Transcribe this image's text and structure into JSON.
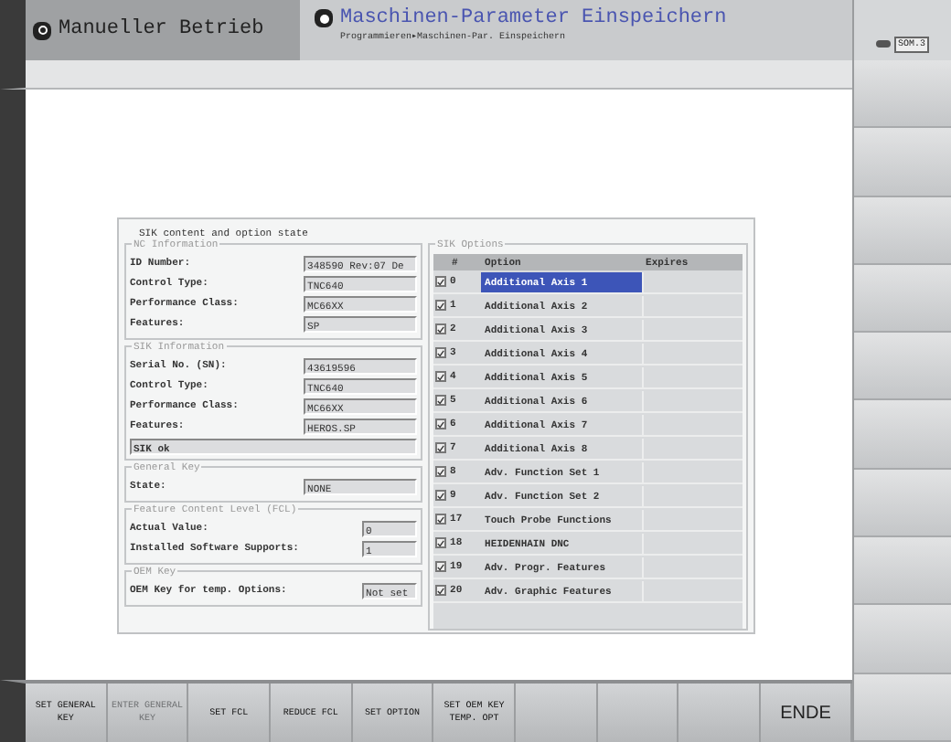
{
  "header": {
    "mode": "Manueller Betrieb",
    "title": "Maschinen-Parameter Einspeichern",
    "breadcrumb": "Programmieren▸Maschinen-Par. Einspeichern"
  },
  "side_status": "SOM.3",
  "dialog": {
    "title": "SIK content and option state",
    "groups": [
      {
        "legend": "NC Information",
        "fields": [
          {
            "label": "ID Number:",
            "value": "348590 Rev:07 De"
          },
          {
            "label": "Control Type:",
            "value": "TNC640"
          },
          {
            "label": "Performance Class:",
            "value": "MC66XX"
          },
          {
            "label": "Features:",
            "value": "SP"
          }
        ]
      },
      {
        "legend": "SIK Information",
        "fields": [
          {
            "label": "Serial No. (SN):",
            "value": "43619596"
          },
          {
            "label": "Control Type:",
            "value": "TNC640"
          },
          {
            "label": "Performance Class:",
            "value": "MC66XX"
          },
          {
            "label": "Features:",
            "value": "HEROS.SP"
          }
        ],
        "status": "SIK ok"
      },
      {
        "legend": "General Key",
        "fields": [
          {
            "label": "State:",
            "value": "NONE"
          }
        ]
      },
      {
        "legend": "Feature Content Level (FCL)",
        "fields": [
          {
            "label": "Actual Value:",
            "value": "0"
          },
          {
            "label": "Installed Software Supports:",
            "value": "1"
          }
        ]
      },
      {
        "legend": "OEM Key",
        "fields": [
          {
            "label": "OEM Key for temp. Options:",
            "value": "Not set"
          }
        ]
      }
    ],
    "sik_options": {
      "legend": "SIK Options",
      "columns": [
        "#",
        "Option",
        "Expires"
      ],
      "rows": [
        {
          "checked": true,
          "number": "0",
          "option": "Additional Axis 1",
          "selected": true
        },
        {
          "checked": true,
          "number": "1",
          "option": "Additional Axis 2",
          "selected": false
        },
        {
          "checked": true,
          "number": "2",
          "option": "Additional Axis 3",
          "selected": false
        },
        {
          "checked": true,
          "number": "3",
          "option": "Additional Axis 4",
          "selected": false
        },
        {
          "checked": true,
          "number": "4",
          "option": "Additional Axis 5",
          "selected": false
        },
        {
          "checked": true,
          "number": "5",
          "option": "Additional Axis 6",
          "selected": false
        },
        {
          "checked": true,
          "number": "6",
          "option": "Additional Axis 7",
          "selected": false
        },
        {
          "checked": true,
          "number": "7",
          "option": "Additional Axis 8",
          "selected": false
        },
        {
          "checked": true,
          "number": "8",
          "option": "Adv. Function Set 1",
          "selected": false
        },
        {
          "checked": true,
          "number": "9",
          "option": "Adv. Function Set 2",
          "selected": false
        },
        {
          "checked": true,
          "number": "17",
          "option": "Touch Probe Functions",
          "selected": false
        },
        {
          "checked": true,
          "number": "18",
          "option": "HEIDENHAIN DNC",
          "selected": false
        },
        {
          "checked": true,
          "number": "19",
          "option": "Adv. Progr. Features",
          "selected": false
        },
        {
          "checked": true,
          "number": "20",
          "option": "Adv. Graphic Features",
          "selected": false
        }
      ]
    }
  },
  "softkeys": [
    {
      "kind": "label",
      "label": "SET GENERAL KEY",
      "disabled": false
    },
    {
      "kind": "label",
      "label": "ENTER GENERAL KEY",
      "disabled": true
    },
    {
      "kind": "label",
      "label": "SET FCL",
      "disabled": false
    },
    {
      "kind": "label",
      "label": "REDUCE FCL",
      "disabled": false
    },
    {
      "kind": "label",
      "label": "SET OPTION",
      "disabled": false
    },
    {
      "kind": "label",
      "label": "SET OEM KEY TEMP. OPT",
      "disabled": false
    },
    {
      "kind": "blank"
    },
    {
      "kind": "blank"
    },
    {
      "kind": "blank"
    },
    {
      "kind": "end",
      "label": "ENDE"
    }
  ]
}
